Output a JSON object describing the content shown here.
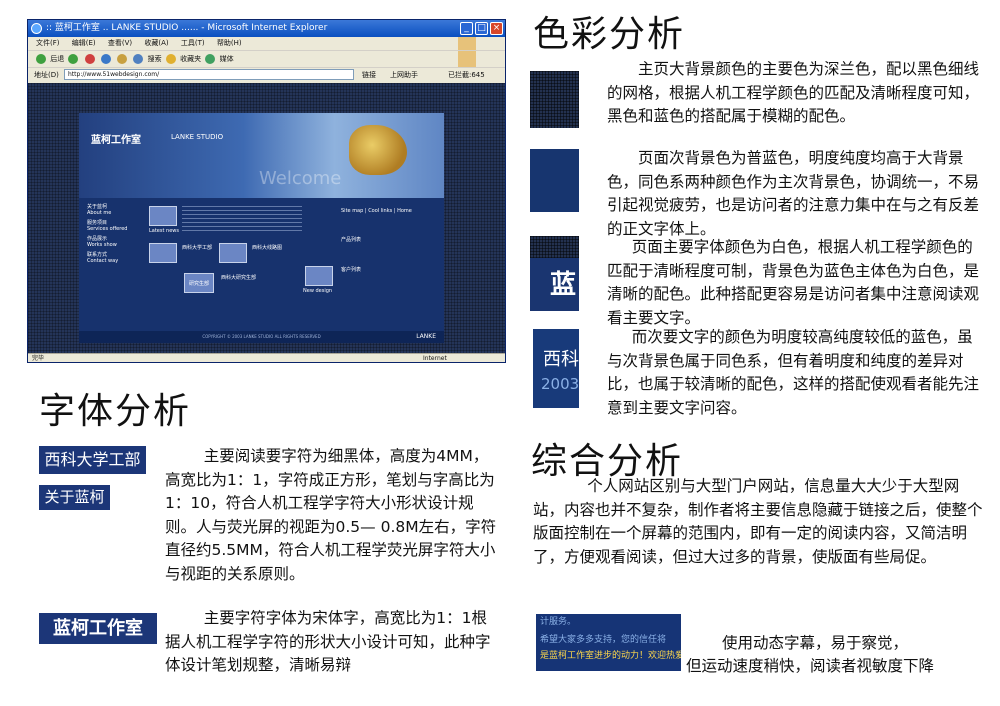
{
  "browser": {
    "title": ":: 蓝柯工作室 .. LANKE STUDIO ...... - Microsoft Internet Explorer",
    "menu": [
      "文件(F)",
      "编辑(E)",
      "查看(V)",
      "收藏(A)",
      "工具(T)",
      "帮助(H)"
    ],
    "toolbar": {
      "back": "后退",
      "search": "搜索",
      "favorites": "收藏夹",
      "media": "媒体"
    },
    "address_label": "地址(D)",
    "address_value": "http://www.51webdesign.com/",
    "go": "转到",
    "links": "链接",
    "online": "上网助手",
    "blocked": "已拦截:645",
    "status_left": "完毕",
    "status_right": "Internet"
  },
  "site": {
    "logo": "蓝柯工作室",
    "logo_en": "LANKE STUDIO",
    "welcome": "Welcome",
    "nav": [
      {
        "cn": "关于蓝柯",
        "en": "About me"
      },
      {
        "cn": "服务项目",
        "en": "Services offered"
      },
      {
        "cn": "作品展示",
        "en": "Works show"
      },
      {
        "cn": "联系方式",
        "en": "Contact way"
      }
    ],
    "latest": "Latest news",
    "new_design": "New design",
    "topnav": [
      "Site map",
      "Cool links",
      "Home"
    ],
    "product_list": "产品列表",
    "customer_list": "客户列表",
    "works": [
      "西科大学工部",
      "西科大线路图",
      "西科大研究生部"
    ],
    "research": "研究生部",
    "footer": "COPYRIGHT © 2003 LANKE STUDIO ALL RIGHTS RESERVED",
    "brand": "LANKE"
  },
  "color_analysis": {
    "heading": "色彩分析",
    "para1": "主页大背景颜色的主要色为深兰色，配以黑色细线的网格，根据人机工程学颜色的匹配及清晰程度可知，黑色和蓝色的搭配属于模糊的配色。",
    "para2": "页面次背景色为普蓝色，明度纯度均高于大背景色，同色系两种颜色作为主次背景色，协调统一，不易引起视觉疲劳，也是访问者的注意力集中在与之有反差的正文字体上。",
    "para3": "页面主要字体颜色为白色，根据人机工程学颜色的匹配于清晰程度可制，背景色为蓝色主体色为白色，是清晰的配色。此种搭配更容易是访问者集中注意阅读观看主要文字。",
    "para4": "而次要文字的颜色为明度较高纯度较低的蓝色，虽与次背景色属于同色系，但有着明度和纯度的差异对比，也属于较清晰的配色，这样的搭配使观看者能先注意到主要文字问容。",
    "swatch3_text": "蓝",
    "swatch4_text_a": "西科",
    "swatch4_text_b": "2003"
  },
  "font_analysis": {
    "heading": "字体分析",
    "sample1": "西科大学工部",
    "sample2": "关于蓝柯",
    "sample3": "蓝柯工作室",
    "para1": "主要阅读要字符为细黑体，高度为4MM，高宽比为1：1，字符成正方形，笔划与字高比为1：10，符合人机工程学字符大小形状设计规则。人与荧光屏的视距为0.5— 0.8M左右，字符直径约5.5MM，符合人机工程学荧光屏字符大小与视距的关系原则。",
    "para2": "主要字符字体为宋体字，高宽比为1：1根据人机工程学字符的形状大小设计可知，此种字体设计笔划规整，清晰易辩"
  },
  "summary": {
    "heading": "综合分析",
    "para1": "个人网站区别与大型门户网站，信息量大大少于大型网站，内容也并不复杂，制作者将主要信息隐藏于链接之后，使整个版面控制在一个屏幕的范围内，即有一定的阅读内容，又简洁明了，方便观看阅读，但过大过多的背景，使版面有些局促。",
    "marquee_lines": [
      "计服务。",
      "希望大家多多支持，您的信任将",
      "是蓝柯工作室进步的动力！欢迎热爱"
    ],
    "para2_line1": "使用动态字幕，易于察觉，",
    "para2_line2": "但运动速度稍快，阅读者视敏度下降"
  },
  "colors": {
    "page_bg": "#ffffff",
    "dark_blue_bg": "#23314f",
    "site_blue": "#17356f",
    "text_white": "#ffffff",
    "secondary_text_blue": "#8ab0e6"
  }
}
